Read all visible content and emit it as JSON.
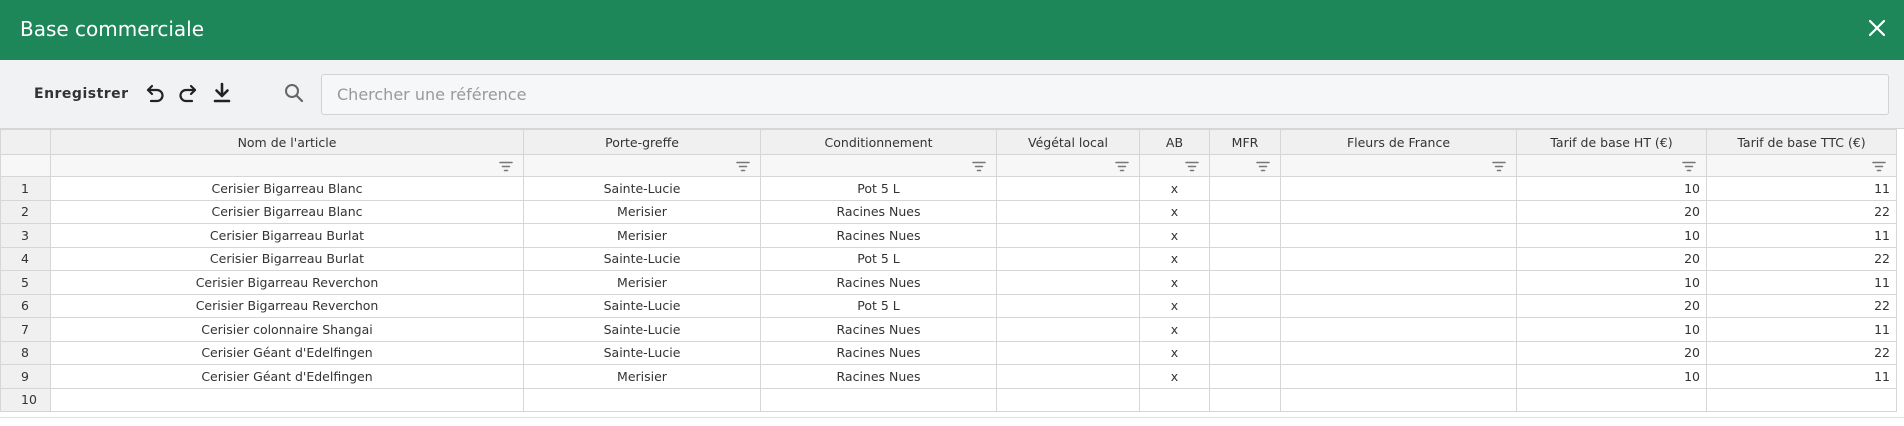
{
  "window": {
    "title": "Base commerciale"
  },
  "toolbar": {
    "save_label": "Enregistrer",
    "undo_icon": "undo-icon",
    "redo_icon": "redo-icon",
    "download_icon": "download-icon"
  },
  "search": {
    "placeholder": "Chercher une référence",
    "value": ""
  },
  "colors": {
    "accent": "#1e8759",
    "header_bg": "#f0f0f0",
    "toolbar_bg": "#f1f2f4"
  },
  "table": {
    "columns": [
      "Nom de l'article",
      "Porte-greffe",
      "Conditionnement",
      "Végétal local",
      "AB",
      "MFR",
      "Fleurs de France",
      "Tarif de base HT (€)",
      "Tarif de base TTC (€)"
    ],
    "rows": [
      {
        "n": "1",
        "cells": [
          "Cerisier Bigarreau Blanc",
          "Sainte-Lucie",
          "Pot 5 L",
          "",
          "x",
          "",
          "",
          "10",
          "11"
        ]
      },
      {
        "n": "2",
        "cells": [
          "Cerisier Bigarreau Blanc",
          "Merisier",
          "Racines Nues",
          "",
          "x",
          "",
          "",
          "20",
          "22"
        ]
      },
      {
        "n": "3",
        "cells": [
          "Cerisier Bigarreau Burlat",
          "Merisier",
          "Racines Nues",
          "",
          "x",
          "",
          "",
          "10",
          "11"
        ]
      },
      {
        "n": "4",
        "cells": [
          "Cerisier Bigarreau Burlat",
          "Sainte-Lucie",
          "Pot 5 L",
          "",
          "x",
          "",
          "",
          "20",
          "22"
        ]
      },
      {
        "n": "5",
        "cells": [
          "Cerisier Bigarreau Reverchon",
          "Merisier",
          "Racines Nues",
          "",
          "x",
          "",
          "",
          "10",
          "11"
        ]
      },
      {
        "n": "6",
        "cells": [
          "Cerisier Bigarreau Reverchon",
          "Sainte-Lucie",
          "Pot 5 L",
          "",
          "x",
          "",
          "",
          "20",
          "22"
        ]
      },
      {
        "n": "7",
        "cells": [
          "Cerisier colonnaire Shangai",
          "Sainte-Lucie",
          "Racines Nues",
          "",
          "x",
          "",
          "",
          "10",
          "11"
        ]
      },
      {
        "n": "8",
        "cells": [
          "Cerisier Géant d'Edelfingen",
          "Sainte-Lucie",
          "Racines Nues",
          "",
          "x",
          "",
          "",
          "20",
          "22"
        ]
      },
      {
        "n": "9",
        "cells": [
          "Cerisier Géant d'Edelfingen",
          "Merisier",
          "Racines Nues",
          "",
          "x",
          "",
          "",
          "10",
          "11"
        ]
      },
      {
        "n": "10",
        "cells": [
          "",
          "",
          "",
          "",
          "",
          "",
          "",
          "",
          ""
        ]
      }
    ]
  }
}
